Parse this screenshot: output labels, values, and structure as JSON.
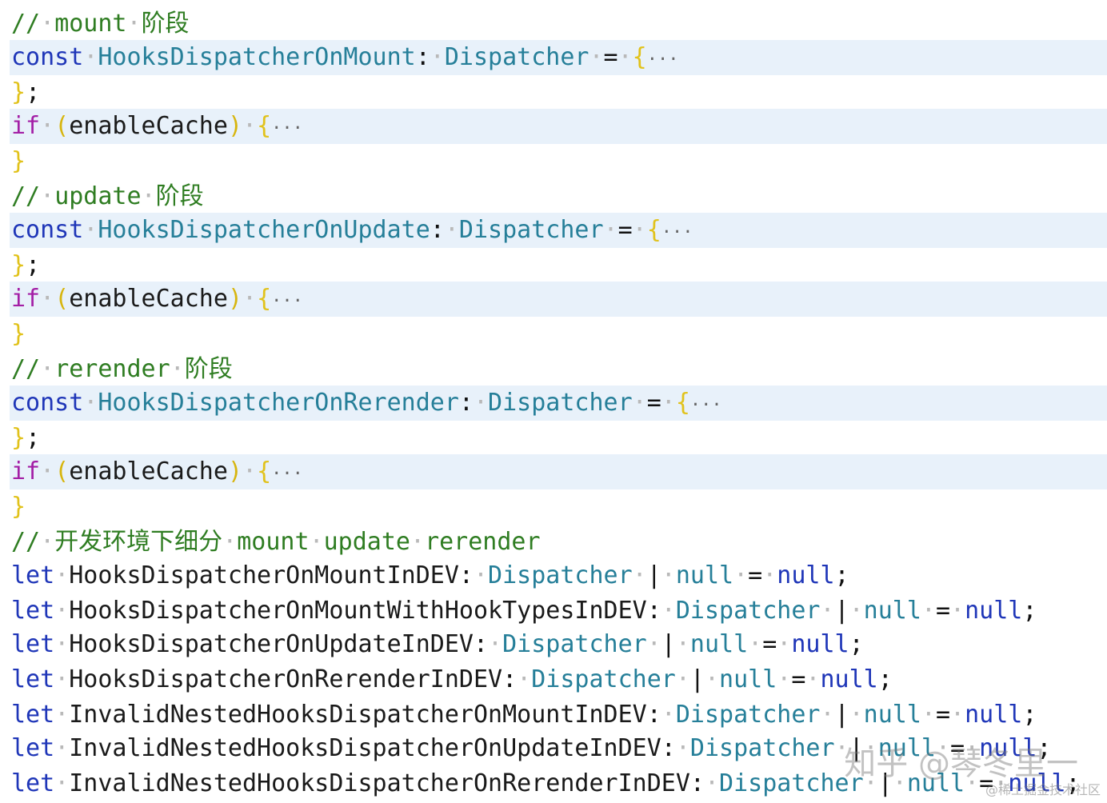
{
  "code": {
    "lines": [
      {
        "folded": false,
        "tokens": [
          [
            "comment",
            "//"
          ],
          [
            "dot",
            "·"
          ],
          [
            "comment",
            "mount"
          ],
          [
            "dot",
            "·"
          ],
          [
            "comment",
            "阶段"
          ]
        ]
      },
      {
        "folded": true,
        "tokens": [
          [
            "keyword",
            "const"
          ],
          [
            "dot",
            "·"
          ],
          [
            "type",
            "HooksDispatcherOnMount"
          ],
          [
            "plain",
            ":"
          ],
          [
            "dot",
            "·"
          ],
          [
            "type",
            "Dispatcher"
          ],
          [
            "dot",
            "·"
          ],
          [
            "plain",
            "="
          ],
          [
            "dot",
            "·"
          ],
          [
            "brace",
            "{"
          ],
          [
            "ellipsis",
            "···"
          ]
        ]
      },
      {
        "folded": false,
        "tokens": [
          [
            "brace",
            "}"
          ],
          [
            "plain",
            ";"
          ]
        ]
      },
      {
        "folded": true,
        "tokens": [
          [
            "if",
            "if"
          ],
          [
            "dot",
            "·"
          ],
          [
            "paren",
            "("
          ],
          [
            "ident",
            "enableCache"
          ],
          [
            "paren",
            ")"
          ],
          [
            "dot",
            "·"
          ],
          [
            "brace",
            "{"
          ],
          [
            "ellipsis",
            "···"
          ]
        ]
      },
      {
        "folded": false,
        "tokens": [
          [
            "brace",
            "}"
          ]
        ]
      },
      {
        "folded": false,
        "tokens": [
          [
            "comment",
            "//"
          ],
          [
            "dot",
            "·"
          ],
          [
            "comment",
            "update"
          ],
          [
            "dot",
            "·"
          ],
          [
            "comment",
            "阶段"
          ]
        ]
      },
      {
        "folded": true,
        "tokens": [
          [
            "keyword",
            "const"
          ],
          [
            "dot",
            "·"
          ],
          [
            "type",
            "HooksDispatcherOnUpdate"
          ],
          [
            "plain",
            ":"
          ],
          [
            "dot",
            "·"
          ],
          [
            "type",
            "Dispatcher"
          ],
          [
            "dot",
            "·"
          ],
          [
            "plain",
            "="
          ],
          [
            "dot",
            "·"
          ],
          [
            "brace",
            "{"
          ],
          [
            "ellipsis",
            "···"
          ]
        ]
      },
      {
        "folded": false,
        "tokens": [
          [
            "brace",
            "}"
          ],
          [
            "plain",
            ";"
          ]
        ]
      },
      {
        "folded": true,
        "tokens": [
          [
            "if",
            "if"
          ],
          [
            "dot",
            "·"
          ],
          [
            "paren",
            "("
          ],
          [
            "ident",
            "enableCache"
          ],
          [
            "paren",
            ")"
          ],
          [
            "dot",
            "·"
          ],
          [
            "brace",
            "{"
          ],
          [
            "ellipsis",
            "···"
          ]
        ]
      },
      {
        "folded": false,
        "tokens": [
          [
            "brace",
            "}"
          ]
        ]
      },
      {
        "folded": false,
        "tokens": [
          [
            "comment",
            "//"
          ],
          [
            "dot",
            "·"
          ],
          [
            "comment",
            "rerender"
          ],
          [
            "dot",
            "·"
          ],
          [
            "comment",
            "阶段"
          ]
        ]
      },
      {
        "folded": true,
        "tokens": [
          [
            "keyword",
            "const"
          ],
          [
            "dot",
            "·"
          ],
          [
            "type",
            "HooksDispatcherOnRerender"
          ],
          [
            "plain",
            ":"
          ],
          [
            "dot",
            "·"
          ],
          [
            "type",
            "Dispatcher"
          ],
          [
            "dot",
            "·"
          ],
          [
            "plain",
            "="
          ],
          [
            "dot",
            "·"
          ],
          [
            "brace",
            "{"
          ],
          [
            "ellipsis",
            "···"
          ]
        ]
      },
      {
        "folded": false,
        "tokens": [
          [
            "brace",
            "}"
          ],
          [
            "plain",
            ";"
          ]
        ]
      },
      {
        "folded": true,
        "tokens": [
          [
            "if",
            "if"
          ],
          [
            "dot",
            "·"
          ],
          [
            "paren",
            "("
          ],
          [
            "ident",
            "enableCache"
          ],
          [
            "paren",
            ")"
          ],
          [
            "dot",
            "·"
          ],
          [
            "brace",
            "{"
          ],
          [
            "ellipsis",
            "···"
          ]
        ]
      },
      {
        "folded": false,
        "tokens": [
          [
            "brace",
            "}"
          ]
        ]
      },
      {
        "folded": false,
        "tokens": [
          [
            "comment",
            "//"
          ],
          [
            "dot",
            "·"
          ],
          [
            "comment",
            "开发环境下细分"
          ],
          [
            "dot",
            "·"
          ],
          [
            "comment",
            "mount"
          ],
          [
            "dot",
            "·"
          ],
          [
            "comment",
            "update"
          ],
          [
            "dot",
            "·"
          ],
          [
            "comment",
            "rerender"
          ]
        ]
      },
      {
        "folded": false,
        "tokens": [
          [
            "keyword",
            "let"
          ],
          [
            "dot",
            "·"
          ],
          [
            "ident",
            "HooksDispatcherOnMountInDEV"
          ],
          [
            "plain",
            ":"
          ],
          [
            "dot",
            "·"
          ],
          [
            "type",
            "Dispatcher"
          ],
          [
            "dot",
            "·"
          ],
          [
            "plain",
            "|"
          ],
          [
            "dot",
            "·"
          ],
          [
            "type",
            "null"
          ],
          [
            "dot",
            "·"
          ],
          [
            "plain",
            "="
          ],
          [
            "dot",
            "·"
          ],
          [
            "null",
            "null"
          ],
          [
            "plain",
            ";"
          ]
        ]
      },
      {
        "folded": false,
        "tokens": [
          [
            "keyword",
            "let"
          ],
          [
            "dot",
            "·"
          ],
          [
            "ident",
            "HooksDispatcherOnMountWithHookTypesInDEV"
          ],
          [
            "plain",
            ":"
          ],
          [
            "dot",
            "·"
          ],
          [
            "type",
            "Dispatcher"
          ],
          [
            "dot",
            "·"
          ],
          [
            "plain",
            "|"
          ],
          [
            "dot",
            "·"
          ],
          [
            "type",
            "null"
          ],
          [
            "dot",
            "·"
          ],
          [
            "plain",
            "="
          ],
          [
            "dot",
            "·"
          ],
          [
            "null",
            "null"
          ],
          [
            "plain",
            ";"
          ]
        ]
      },
      {
        "folded": false,
        "tokens": [
          [
            "keyword",
            "let"
          ],
          [
            "dot",
            "·"
          ],
          [
            "ident",
            "HooksDispatcherOnUpdateInDEV"
          ],
          [
            "plain",
            ":"
          ],
          [
            "dot",
            "·"
          ],
          [
            "type",
            "Dispatcher"
          ],
          [
            "dot",
            "·"
          ],
          [
            "plain",
            "|"
          ],
          [
            "dot",
            "·"
          ],
          [
            "type",
            "null"
          ],
          [
            "dot",
            "·"
          ],
          [
            "plain",
            "="
          ],
          [
            "dot",
            "·"
          ],
          [
            "null",
            "null"
          ],
          [
            "plain",
            ";"
          ]
        ]
      },
      {
        "folded": false,
        "tokens": [
          [
            "keyword",
            "let"
          ],
          [
            "dot",
            "·"
          ],
          [
            "ident",
            "HooksDispatcherOnRerenderInDEV"
          ],
          [
            "plain",
            ":"
          ],
          [
            "dot",
            "·"
          ],
          [
            "type",
            "Dispatcher"
          ],
          [
            "dot",
            "·"
          ],
          [
            "plain",
            "|"
          ],
          [
            "dot",
            "·"
          ],
          [
            "type",
            "null"
          ],
          [
            "dot",
            "·"
          ],
          [
            "plain",
            "="
          ],
          [
            "dot",
            "·"
          ],
          [
            "null",
            "null"
          ],
          [
            "plain",
            ";"
          ]
        ]
      },
      {
        "folded": false,
        "tokens": [
          [
            "keyword",
            "let"
          ],
          [
            "dot",
            "·"
          ],
          [
            "ident",
            "InvalidNestedHooksDispatcherOnMountInDEV"
          ],
          [
            "plain",
            ":"
          ],
          [
            "dot",
            "·"
          ],
          [
            "type",
            "Dispatcher"
          ],
          [
            "dot",
            "·"
          ],
          [
            "plain",
            "|"
          ],
          [
            "dot",
            "·"
          ],
          [
            "type",
            "null"
          ],
          [
            "dot",
            "·"
          ],
          [
            "plain",
            "="
          ],
          [
            "dot",
            "·"
          ],
          [
            "null",
            "null"
          ],
          [
            "plain",
            ";"
          ]
        ]
      },
      {
        "folded": false,
        "tokens": [
          [
            "keyword",
            "let"
          ],
          [
            "dot",
            "·"
          ],
          [
            "ident",
            "InvalidNestedHooksDispatcherOnUpdateInDEV"
          ],
          [
            "plain",
            ":"
          ],
          [
            "dot",
            "·"
          ],
          [
            "type",
            "Dispatcher"
          ],
          [
            "dot",
            "·"
          ],
          [
            "plain",
            "|"
          ],
          [
            "dot",
            "·"
          ],
          [
            "type",
            "null"
          ],
          [
            "dot",
            "·"
          ],
          [
            "plain",
            "="
          ],
          [
            "dot",
            "·"
          ],
          [
            "null",
            "null"
          ],
          [
            "plain",
            ";"
          ]
        ]
      },
      {
        "folded": false,
        "tokens": [
          [
            "keyword",
            "let"
          ],
          [
            "dot",
            "·"
          ],
          [
            "ident",
            "InvalidNestedHooksDispatcherOnRerenderInDEV"
          ],
          [
            "plain",
            ":"
          ],
          [
            "dot",
            "·"
          ],
          [
            "type",
            "Dispatcher"
          ],
          [
            "dot",
            "·"
          ],
          [
            "plain",
            "|"
          ],
          [
            "dot",
            "·"
          ],
          [
            "type",
            "null"
          ],
          [
            "dot",
            "·"
          ],
          [
            "plain",
            "="
          ],
          [
            "dot",
            "·"
          ],
          [
            "null",
            "null"
          ],
          [
            "plain",
            ";"
          ]
        ]
      }
    ]
  },
  "watermark": {
    "main": "知乎 @琴冬里一",
    "sub": "@稀土掘金技术社区"
  },
  "colors": {
    "folded_background": "#e8f1fa",
    "comment": "#2f7d22",
    "keyword": "#1f36b8",
    "if_keyword": "#a31fa6",
    "type": "#267f99",
    "brace": "#e1c21b"
  }
}
